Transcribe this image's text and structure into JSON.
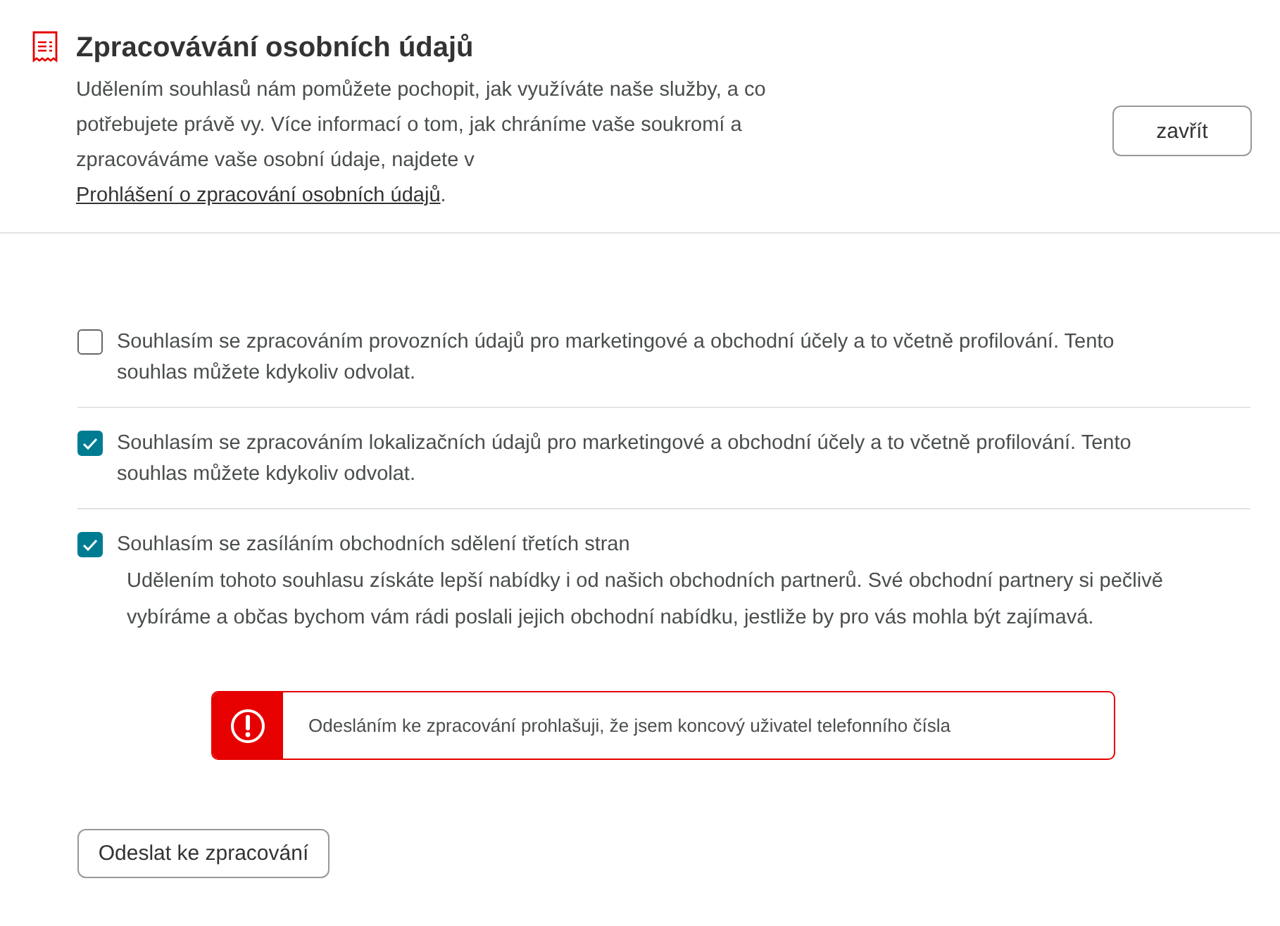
{
  "header": {
    "title": "Zpracovávání osobních údajů",
    "description": "Udělením souhlasů nám pomůžete pochopit, jak využíváte naše služby, a co potřebujete právě vy. Více informací o tom, jak chráníme vaše soukromí a zpracováváme vaše osobní údaje, najdete v ",
    "link": "Prohlášení o zpracování osobních údajů",
    "description_end": ".",
    "close_button": "zavřít"
  },
  "consents": [
    {
      "label": "Souhlasím se zpracováním provozních údajů pro marketingové a obchodní účely a to včetně profilování. Tento souhlas můžete kdykoliv odvolat.",
      "checked": false
    },
    {
      "label": "Souhlasím se zpracováním lokalizačních údajů pro marketingové a obchodní účely a to včetně profilování. Tento souhlas můžete kdykoliv odvolat.",
      "checked": true
    },
    {
      "label": "Souhlasím se zasíláním obchodních sdělení třetích stran",
      "checked": true,
      "note": "Udělením tohoto souhlasu získáte lepší nabídky i od našich obchodních partnerů. Své obchodní partnery si pečlivě vybíráme a občas bychom vám rádi poslali jejich obchodní nabídku, jestliže by pro vás mohla být zajímavá."
    }
  ],
  "alert": {
    "kind": "error",
    "text": "Odesláním ke zpracování prohlašuji, že jsem koncový uživatel telefonního čísla"
  },
  "submit_button": "Odeslat ke zpracování"
}
